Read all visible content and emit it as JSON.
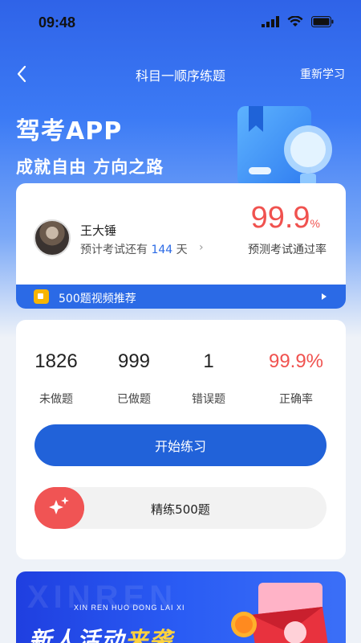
{
  "status_bar": {
    "time": "09:48"
  },
  "nav": {
    "title": "科目一顺序练题",
    "action": "重新学习"
  },
  "brand": {
    "title": "驾考APP",
    "subtitle": "成就自由  方向之路"
  },
  "user": {
    "name": "王大锤",
    "exam_prefix": "预计考试还有",
    "exam_days": "144",
    "exam_suffix": "天",
    "pass_rate": "99.9",
    "pass_rate_unit": "%",
    "pass_label": "预测考试通过率"
  },
  "video_banner": {
    "label": "500题视频推荐"
  },
  "stats": [
    {
      "value": "1826",
      "label": "未做题"
    },
    {
      "value": "999",
      "label": "已做题"
    },
    {
      "value": "1",
      "label": "错误题"
    },
    {
      "value": "99.9%",
      "label": "正确率"
    }
  ],
  "actions": {
    "start": "开始练习",
    "refine": "精练500题"
  },
  "promo": {
    "ghost": "XINREN",
    "small": "XIN REN HUO DONG LAI XI",
    "title_main": "新人活动",
    "title_hl": "来袭"
  },
  "colors": {
    "primary": "#2162d9",
    "accent_red": "#f0524f",
    "highlight": "#ffd23e"
  }
}
